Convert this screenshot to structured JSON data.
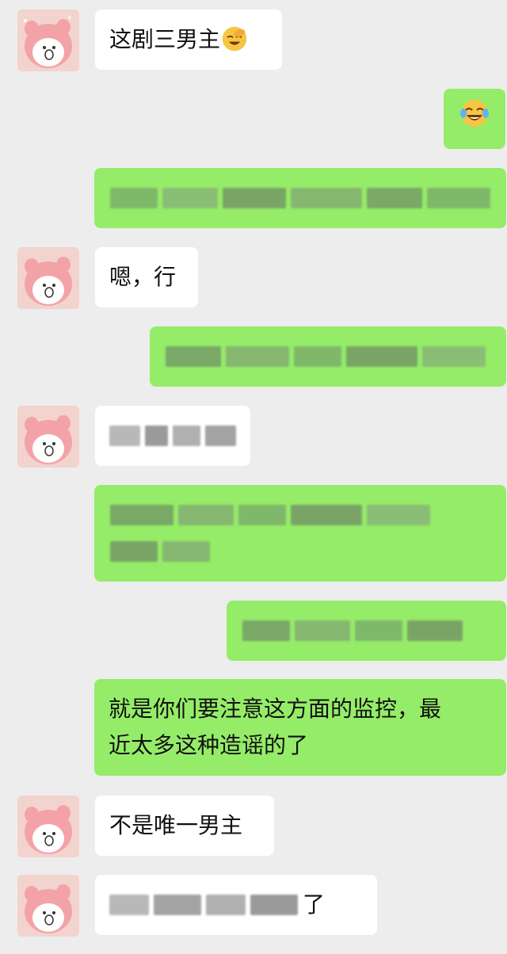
{
  "chat": {
    "messages": [
      {
        "id": "m1",
        "side": "in",
        "text": "这剧三男主"
      },
      {
        "id": "m2",
        "side": "out",
        "emoji": "😂"
      },
      {
        "id": "m3",
        "side": "out",
        "blurred": true
      },
      {
        "id": "m4",
        "side": "in",
        "text": "嗯，行"
      },
      {
        "id": "m5",
        "side": "out",
        "blurred": true
      },
      {
        "id": "m6",
        "side": "in",
        "blurred": true
      },
      {
        "id": "m7",
        "side": "out",
        "blurred": true
      },
      {
        "id": "m8",
        "side": "out",
        "blurred": true
      },
      {
        "id": "m9",
        "side": "out",
        "text_line1": "就是你们要注意这方面的监控，最",
        "text_line2": "近太多这种造谣的了"
      },
      {
        "id": "m10",
        "side": "in",
        "text": "不是唯一男主"
      },
      {
        "id": "m11",
        "side": "in",
        "text_tail": "了"
      }
    ]
  },
  "colors": {
    "background": "#ededed",
    "incoming_bubble": "#ffffff",
    "outgoing_bubble": "#95ec69",
    "avatar_bg": "#f2d3cd"
  }
}
